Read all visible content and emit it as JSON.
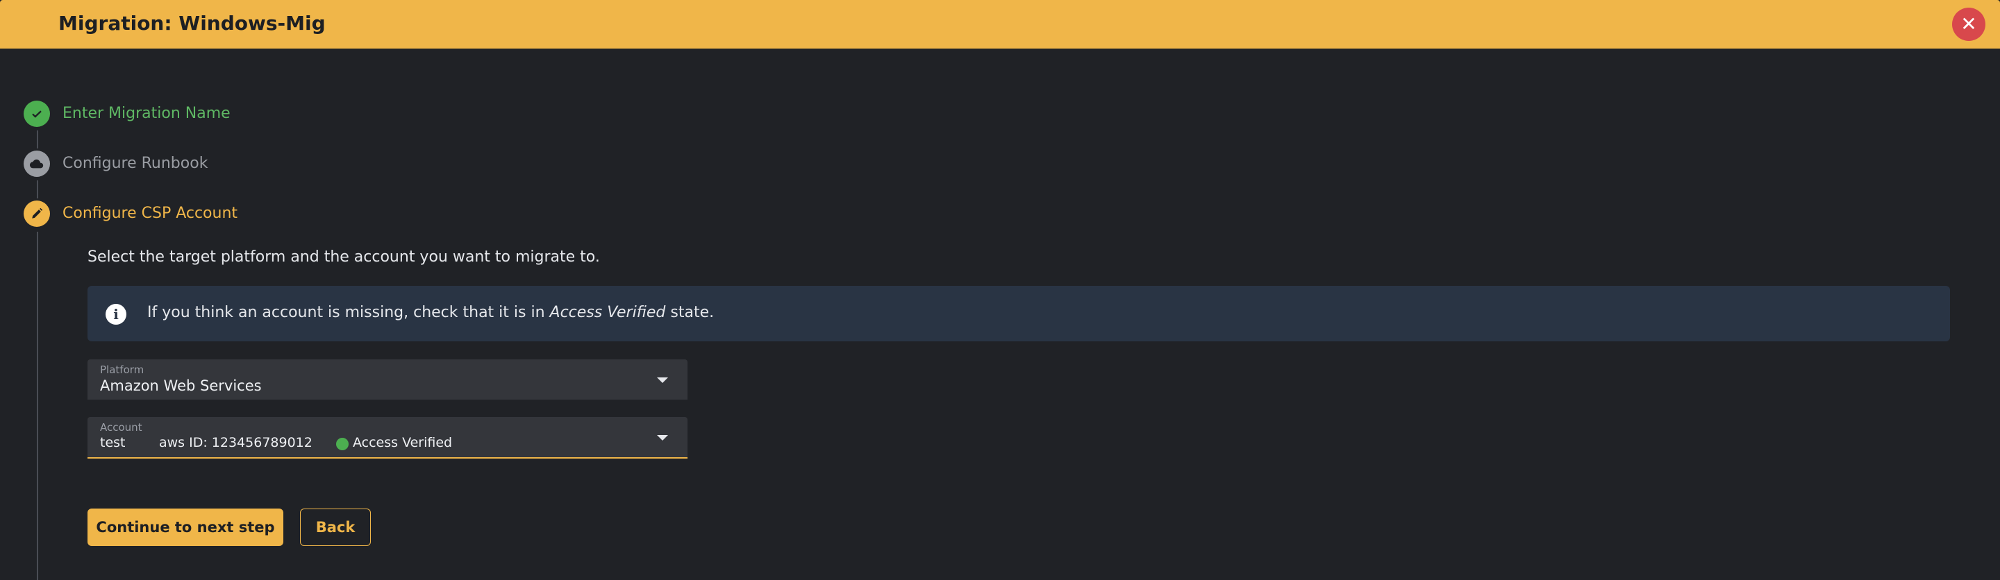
{
  "header": {
    "title": "Migration: Windows-Mig"
  },
  "colors": {
    "accent": "#f0b649",
    "success": "#4caf50",
    "info_bg": "#293444",
    "close": "#d8484c"
  },
  "steps": [
    {
      "label": "Enter Migration Name",
      "status": "completed",
      "icon": "check-icon"
    },
    {
      "label": "Configure Runbook",
      "status": "pending",
      "icon": "cloud-icon"
    },
    {
      "label": "Configure CSP Account",
      "status": "active",
      "icon": "pencil-icon"
    }
  ],
  "csp_step": {
    "description": "Select the target platform and the account you want to migrate to.",
    "info": {
      "icon": "info-icon",
      "text_before": "If you think an account is missing, check that it is in ",
      "text_emphasis": "Access Verified",
      "text_after": " state."
    },
    "platform": {
      "label": "Platform",
      "value": "Amazon Web Services"
    },
    "account": {
      "label": "Account",
      "name": "test",
      "id_text": "aws ID: 123456789012",
      "status": "Access Verified"
    }
  },
  "buttons": {
    "continue": "Continue to next step",
    "back": "Back"
  }
}
